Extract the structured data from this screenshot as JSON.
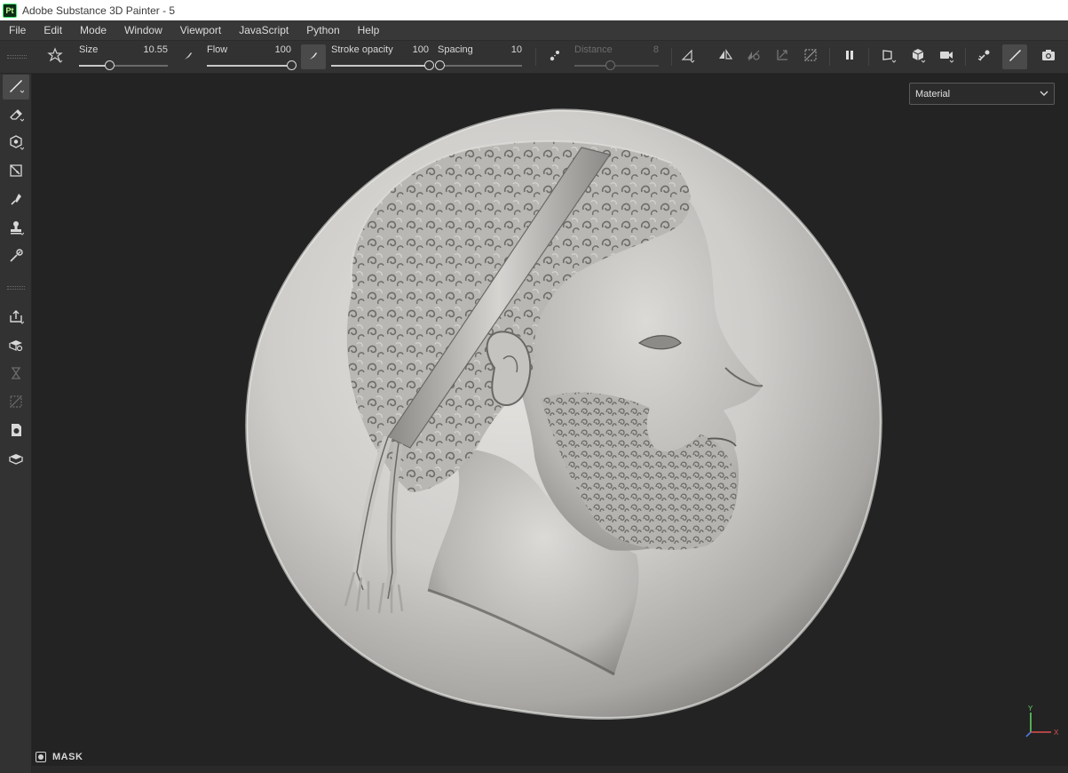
{
  "titlebar": {
    "logo_text": "Pt",
    "title": "Adobe Substance 3D Painter - 5"
  },
  "menu": [
    "File",
    "Edit",
    "Mode",
    "Window",
    "Viewport",
    "JavaScript",
    "Python",
    "Help"
  ],
  "toolbar": {
    "size": {
      "label": "Size",
      "value": "10.55",
      "fraction": 0.34
    },
    "flow": {
      "label": "Flow",
      "value": "100",
      "fraction": 1.0
    },
    "stroke_opacity": {
      "label": "Stroke opacity",
      "value": "100",
      "fraction": 1.0
    },
    "spacing": {
      "label": "Spacing",
      "value": "10",
      "fraction": 0.02
    },
    "distance": {
      "label": "Distance",
      "value": "8",
      "fraction": 0.42,
      "disabled": true
    }
  },
  "viewport": {
    "channel_select": "Material",
    "axis_labels": {
      "y": "Y",
      "x": "X"
    },
    "subject": "Silver relief coin with bearded profile wearing a headband"
  },
  "bottom": {
    "mask_label": "MASK"
  },
  "icons": {
    "toolbar": [
      "brush-preset-icon",
      "alignment-icon",
      "lazy-mouse-icon",
      "symmetry-icon",
      "mirror-icon",
      "mirror-disabled-icon",
      "transform-icon",
      "crop-icon",
      "pause-icon",
      "perspective-icon",
      "cube-icon",
      "camera-icon",
      "color-picker-icon",
      "paint-mode-icon",
      "screenshot-icon"
    ],
    "leftbar": [
      "paint-brush-icon",
      "eraser-icon",
      "projection-icon",
      "polygon-fill-icon",
      "smudge-icon",
      "clone-stamp-icon",
      "color-picker-icon",
      "export-icon",
      "bake-icon",
      "history-icon",
      "iray-icon",
      "display-settings-icon",
      "shelf-icon"
    ]
  },
  "colors": {
    "accent_green": "#3be36d",
    "panel": "#323232",
    "viewport_bg": "#232323"
  }
}
